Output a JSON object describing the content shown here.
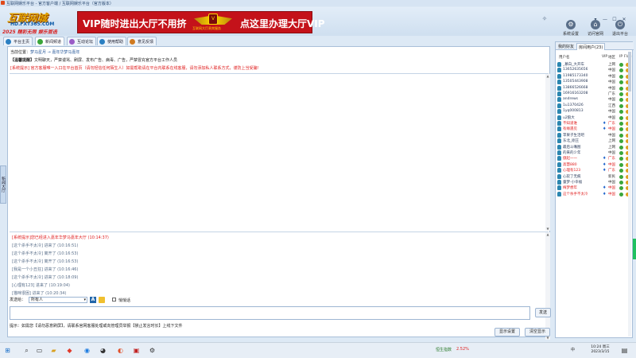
{
  "window": {
    "title": "互联网娱乐平台 - 官方客户端 / 互联网娱乐平台（官方版本）"
  },
  "logo": {
    "name": "互联网城",
    "site": "HD.FXT365.COM",
    "slogan": "2025 精彩无限 娱乐首选"
  },
  "ad": {
    "left_text": "VIP随时进出大厅不用挤",
    "right_text": "点这里办理大厅VIP",
    "emblem_text": "互联网大厅贵宾服务",
    "badge": "V"
  },
  "top_buttons": [
    {
      "label": "系统设置",
      "icon": "gear-icon",
      "glyph": "⚙"
    },
    {
      "label": "访问官网",
      "icon": "home-icon",
      "glyph": "⌂"
    },
    {
      "label": "退出平台",
      "icon": "exit-icon",
      "glyph": "⏻"
    }
  ],
  "window_controls": {
    "minimize": "—",
    "maximize": "☐",
    "close": "✕",
    "skin": "✧",
    "menu": "▾"
  },
  "tabs": [
    {
      "label": "平台主页",
      "color": "#2a7fc2"
    },
    {
      "label": "新闻频道",
      "color": "#3aa63a"
    },
    {
      "label": "互动论坛",
      "color": "#9a5cc6"
    },
    {
      "label": "使用帮助",
      "color": "#2a7fc2"
    },
    {
      "label": "意见反馈",
      "color": "#d07a20"
    }
  ],
  "location": {
    "label": "当前位置：",
    "path": "梦马星月  →  嘉年华梦马嘉年"
  },
  "notice": {
    "label": "【温馨提醒】",
    "text": "文明聊天，严禁谩骂、刷屏、发布广告、病毒、广告，严禁冒充官方平台工作人员"
  },
  "warning": "[系统提示] 官方客服唯一入口在平台首页（请勿轻信任何陌生人）如需帮助请在平台内联系在线客服，请勿添加私人联系方式，谨防上当受骗!",
  "chat": [
    {
      "text": "[系统提示]您已经进入嘉年华梦马嘉年大厅 (10:14:37)",
      "type": "sys"
    },
    {
      "text": "[这个杀手不太冷] 进来了 (10:16:51)",
      "type": "normal"
    },
    {
      "text": "[这个杀手不太冷] 离开了 (10:16:53)",
      "type": "normal"
    },
    {
      "text": "[这个杀手不太冷] 离开了 (10:16:53)",
      "type": "normal"
    },
    {
      "text": "[我是一个小丑狂] 进来了 (10:16:46)",
      "type": "normal"
    },
    {
      "text": "[这个杀手不太冷] 进来了 (10:18:09)",
      "type": "normal"
    },
    {
      "text": "[心理有123] 进来了 (10:19:04)",
      "type": "normal"
    },
    {
      "text": "[猫咪很困] 进来了 (10:20:34)",
      "type": "normal"
    }
  ],
  "input": {
    "send_to_label": "发送给：",
    "target": "所有人",
    "checkbox_label": "悄悄话",
    "placeholder": "",
    "send_label": "发送"
  },
  "footer": {
    "tip": "提示：如需您【请勿恶意刷屏】，请联系官网客服处理或向管理员举报【禁止发言时长】上线下文件",
    "btn_settings": "显示设置",
    "btn_clear": "清空显示"
  },
  "right_panel": {
    "tabs": [
      "我的好友",
      "房间用户(23)"
    ],
    "headers": {
      "name": "用户名",
      "vip": "VIP",
      "loc": "地区",
      "status": "IP",
      "flag": "Flag"
    },
    "users": [
      {
        "name": "_慕白_大开车",
        "loc": "上网",
        "hl": false
      },
      {
        "name": "13652635656",
        "loc": "中国",
        "hl": false
      },
      {
        "name": "11985173340",
        "loc": "中国",
        "hl": false
      },
      {
        "name": "13505443908",
        "loc": "中国",
        "hl": false
      },
      {
        "name": "13866526668",
        "loc": "中国",
        "hl": false
      },
      {
        "name": "16916163208",
        "loc": "广东",
        "hl": false
      },
      {
        "name": "andrews",
        "loc": "中国",
        "hl": false
      },
      {
        "name": "1u1370426",
        "loc": "江西",
        "hl": false
      },
      {
        "name": "1yq000813",
        "loc": "中国",
        "hl": false
      },
      {
        "name": "u2狼大",
        "loc": "中国",
        "hl": false
      },
      {
        "name": "不知道谁",
        "loc": "广东",
        "hl": true
      },
      {
        "name": "有缘遇见",
        "loc": "中国",
        "hl": true
      },
      {
        "name": "苹果子生活吧",
        "loc": "中国",
        "hl": false
      },
      {
        "name": "东北_刚王",
        "loc": "上网",
        "hl": false
      },
      {
        "name": "最后斗嘴图",
        "loc": "上网",
        "hl": false
      },
      {
        "name": "的来的少年",
        "loc": "中国",
        "hl": false
      },
      {
        "name": "傲起一一",
        "loc": "广东",
        "hl": true
      },
      {
        "name": "高慧880",
        "loc": "中国",
        "hl": true
      },
      {
        "name": "心理有123",
        "loc": "广东",
        "hl": true
      },
      {
        "name": "心软了无痕",
        "loc": "新民",
        "hl": false
      },
      {
        "name": "童梦-小幸福",
        "loc": "中国",
        "hl": false
      },
      {
        "name": "梅梦想年",
        "loc": "中国",
        "hl": true
      },
      {
        "name": "这个杀手不太冷",
        "loc": "中国",
        "hl": true
      }
    ]
  },
  "taskbar": {
    "stock_name": "恒生指数",
    "stock_change": "2.52%",
    "time": "10:24 周三",
    "date": "2023/3/15",
    "input_method": "中",
    "apps": [
      "开始",
      "搜索",
      "文件",
      "浏览器",
      "聊天",
      "企鹅",
      "游戏",
      "音乐",
      "视频",
      "设置"
    ]
  }
}
